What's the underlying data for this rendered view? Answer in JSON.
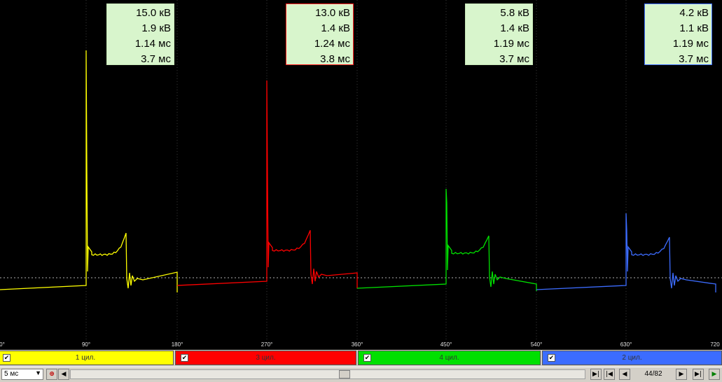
{
  "measurements": [
    {
      "peak": "15.0 кВ",
      "burn_voltage": "1.9 кВ",
      "burn_time": "1.14 мс",
      "dwell": "3.7 мс",
      "border": "#c8e8b8"
    },
    {
      "peak": "13.0 кВ",
      "burn_voltage": "1.4 кВ",
      "burn_time": "1.24 мс",
      "dwell": "3.8 мс",
      "border": "#ff2020"
    },
    {
      "peak": "5.8 кВ",
      "burn_voltage": "1.4 кВ",
      "burn_time": "1.19 мс",
      "dwell": "3.7 мс",
      "border": "#c8e8b8"
    },
    {
      "peak": "4.2 кВ",
      "burn_voltage": "1.1 кВ",
      "burn_time": "1.19 мс",
      "dwell": "3.7 мс",
      "border": "#4070ff"
    }
  ],
  "axis_ticks": [
    "0°",
    "90°",
    "180°",
    "270°",
    "360°",
    "450°",
    "540°",
    "630°",
    "720"
  ],
  "channels": [
    {
      "label": "1 цил.",
      "color": "#ffff00",
      "checked": true
    },
    {
      "label": "3 цил.",
      "color": "#ff0000",
      "checked": true
    },
    {
      "label": "4 цил.",
      "color": "#00e000",
      "checked": true
    },
    {
      "label": "2 цил.",
      "color": "#3c6cff",
      "checked": true
    }
  ],
  "controls": {
    "timebase": "5 мс",
    "page_indicator": "44/82"
  },
  "icons": {
    "zoom": "zoom-in-icon",
    "scroll_left": "arrow-left-icon",
    "nav_first": "first-icon",
    "nav_prev": "prev-icon",
    "nav_next": "next-icon",
    "nav_last": "last-icon",
    "play": "play-icon"
  }
}
